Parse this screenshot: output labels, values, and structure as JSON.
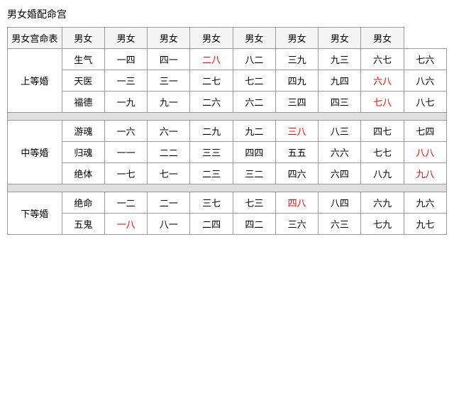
{
  "title": "男女婚配命宫",
  "tableHeader": {
    "col0": "男女宫命表",
    "cols": [
      "男女",
      "男女",
      "男女",
      "男女",
      "男女",
      "男女",
      "男女",
      "男女"
    ]
  },
  "groups": [
    {
      "grade": "上等婚",
      "rows": [
        {
          "label": "生气",
          "cells": [
            {
              "text": "一四",
              "red": false
            },
            {
              "text": "四一",
              "red": false
            },
            {
              "text": "二八",
              "red": true
            },
            {
              "text": "八二",
              "red": false
            },
            {
              "text": "三九",
              "red": false
            },
            {
              "text": "九三",
              "red": false
            },
            {
              "text": "六七",
              "red": false
            },
            {
              "text": "七六",
              "red": false
            }
          ]
        },
        {
          "label": "天医",
          "cells": [
            {
              "text": "一三",
              "red": false
            },
            {
              "text": "三一",
              "red": false
            },
            {
              "text": "二七",
              "red": false
            },
            {
              "text": "七二",
              "red": false
            },
            {
              "text": "四九",
              "red": false
            },
            {
              "text": "九四",
              "red": false
            },
            {
              "text": "六八",
              "red": true
            },
            {
              "text": "八六",
              "red": false
            }
          ]
        },
        {
          "label": "福德",
          "cells": [
            {
              "text": "一九",
              "red": false
            },
            {
              "text": "九一",
              "red": false
            },
            {
              "text": "二六",
              "red": false
            },
            {
              "text": "六二",
              "red": false
            },
            {
              "text": "三四",
              "red": false
            },
            {
              "text": "四三",
              "red": false
            },
            {
              "text": "七八",
              "red": true
            },
            {
              "text": "八七",
              "red": false
            }
          ]
        }
      ]
    },
    {
      "grade": "中等婚",
      "rows": [
        {
          "label": "游魂",
          "cells": [
            {
              "text": "一六",
              "red": false
            },
            {
              "text": "六一",
              "red": false
            },
            {
              "text": "二九",
              "red": false
            },
            {
              "text": "九二",
              "red": false
            },
            {
              "text": "三八",
              "red": true
            },
            {
              "text": "八三",
              "red": false
            },
            {
              "text": "四七",
              "red": false
            },
            {
              "text": "七四",
              "red": false
            }
          ]
        },
        {
          "label": "归魂",
          "cells": [
            {
              "text": "一一",
              "red": false
            },
            {
              "text": "二二",
              "red": false
            },
            {
              "text": "三三",
              "red": false
            },
            {
              "text": "四四",
              "red": false
            },
            {
              "text": "五五",
              "red": false
            },
            {
              "text": "六六",
              "red": false
            },
            {
              "text": "七七",
              "red": false
            },
            {
              "text": "八八",
              "red": true
            }
          ]
        },
        {
          "label": "绝体",
          "cells": [
            {
              "text": "一七",
              "red": false
            },
            {
              "text": "七一",
              "red": false
            },
            {
              "text": "二三",
              "red": false
            },
            {
              "text": "三二",
              "red": false
            },
            {
              "text": "四六",
              "red": false
            },
            {
              "text": "六四",
              "red": false
            },
            {
              "text": "八九",
              "red": false
            },
            {
              "text": "九八",
              "red": true
            }
          ]
        }
      ]
    },
    {
      "grade": "下等婚",
      "rows": [
        {
          "label": "绝命",
          "cells": [
            {
              "text": "一二",
              "red": false
            },
            {
              "text": "二一",
              "red": false
            },
            {
              "text": "三七",
              "red": false
            },
            {
              "text": "七三",
              "red": false
            },
            {
              "text": "四八",
              "red": true
            },
            {
              "text": "八四",
              "red": false
            },
            {
              "text": "六九",
              "red": false
            },
            {
              "text": "九六",
              "red": false
            }
          ]
        },
        {
          "label": "五鬼",
          "cells": [
            {
              "text": "一八",
              "red": true
            },
            {
              "text": "八一",
              "red": false
            },
            {
              "text": "二四",
              "red": false
            },
            {
              "text": "四二",
              "red": false
            },
            {
              "text": "三六",
              "red": false
            },
            {
              "text": "六三",
              "red": false
            },
            {
              "text": "七九",
              "red": false
            },
            {
              "text": "九七",
              "red": false
            }
          ]
        }
      ]
    }
  ]
}
